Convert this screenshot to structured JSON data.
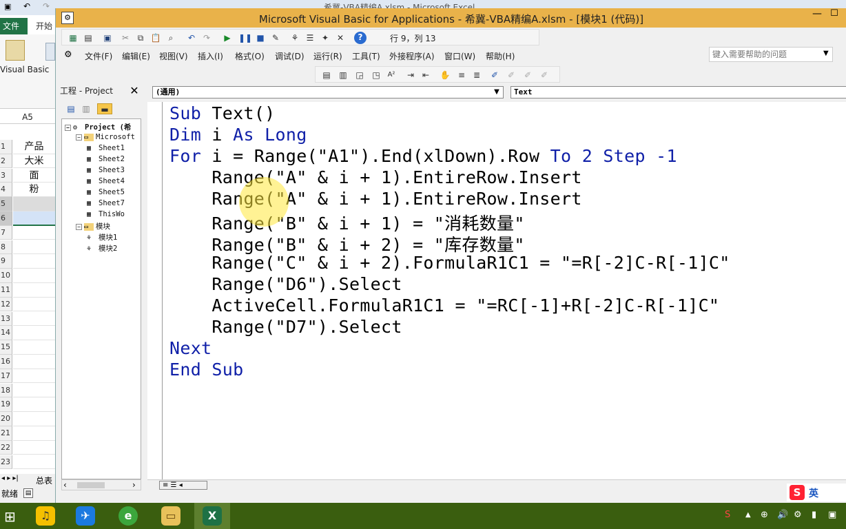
{
  "excel": {
    "title": "希冀-VBA精编A.xlsm - Microsoft Excel",
    "tab_file": "文件",
    "tab_start": "开始",
    "vb_label": "Visual Basic",
    "namebox": "A5",
    "col_a": "A",
    "rows": [
      {
        "n": "1",
        "v": "产品"
      },
      {
        "n": "2",
        "v": "大米"
      },
      {
        "n": "3",
        "v": "面"
      },
      {
        "n": "4",
        "v": "粉"
      },
      {
        "n": "5",
        "v": ""
      },
      {
        "n": "6",
        "v": ""
      },
      {
        "n": "7",
        "v": ""
      },
      {
        "n": "8",
        "v": ""
      },
      {
        "n": "9",
        "v": ""
      },
      {
        "n": "10",
        "v": ""
      },
      {
        "n": "11",
        "v": ""
      },
      {
        "n": "12",
        "v": ""
      },
      {
        "n": "13",
        "v": ""
      },
      {
        "n": "14",
        "v": ""
      },
      {
        "n": "15",
        "v": ""
      },
      {
        "n": "16",
        "v": ""
      },
      {
        "n": "17",
        "v": ""
      },
      {
        "n": "18",
        "v": ""
      },
      {
        "n": "19",
        "v": ""
      },
      {
        "n": "20",
        "v": ""
      },
      {
        "n": "21",
        "v": ""
      },
      {
        "n": "22",
        "v": ""
      },
      {
        "n": "23",
        "v": ""
      }
    ],
    "sheet_tab": "总表",
    "status": "就绪"
  },
  "vbe": {
    "title": "Microsoft Visual Basic for Applications - 希冀-VBA精编A.xlsm - [模块1 (代码)]",
    "cursor_position": "行 9，列 13",
    "menu": [
      "文件(F)",
      "编辑(E)",
      "视图(V)",
      "插入(I)",
      "格式(O)",
      "调试(D)",
      "运行(R)",
      "工具(T)",
      "外接程序(A)",
      "窗口(W)",
      "帮助(H)"
    ],
    "help_placeholder": "键入需要帮助的问题",
    "project_title": "工程 - Project",
    "tree": [
      {
        "label": "Project (希",
        "level": 0,
        "box": "−"
      },
      {
        "label": "Microsoft",
        "level": 1,
        "box": "−"
      },
      {
        "label": "Sheet1",
        "level": 2,
        "box": ""
      },
      {
        "label": "Sheet2",
        "level": 2,
        "box": ""
      },
      {
        "label": "Sheet3",
        "level": 2,
        "box": ""
      },
      {
        "label": "Sheet4",
        "level": 2,
        "box": ""
      },
      {
        "label": "Sheet5",
        "level": 2,
        "box": ""
      },
      {
        "label": "Sheet7",
        "level": 2,
        "box": ""
      },
      {
        "label": "ThisWo",
        "level": 2,
        "box": ""
      },
      {
        "label": "模块",
        "level": 1,
        "box": "−"
      },
      {
        "label": "模块1",
        "level": 2,
        "box": ""
      },
      {
        "label": "模块2",
        "level": 2,
        "box": ""
      }
    ],
    "combo_object": "(通用)",
    "combo_procedure": "Text",
    "code": [
      {
        "indent": "",
        "kw1": "Sub",
        "rest": " Text()",
        "kw2": "",
        "tail": ""
      },
      {
        "indent": "",
        "kw1": "Dim",
        "rest": " i ",
        "kw2": "As Long",
        "tail": ""
      },
      {
        "indent": "",
        "kw1": "For",
        "rest": " i = Range(\"A1\").End(xlDown).Row ",
        "kw2": "To",
        "tail": " 2 Step -1"
      },
      {
        "indent": "    ",
        "kw1": "",
        "rest": "Range(\"A\" & i + 1).EntireRow.Insert",
        "kw2": "",
        "tail": ""
      },
      {
        "indent": "    ",
        "kw1": "",
        "rest": "Range(\"A\" & i + 1).EntireRow.Insert",
        "kw2": "",
        "tail": ""
      },
      {
        "indent": "    ",
        "kw1": "",
        "rest": "Range(\"B\" & i + 1) = \"消耗数量\"",
        "kw2": "",
        "tail": ""
      },
      {
        "indent": "    ",
        "kw1": "",
        "rest": "Range(\"B\" & i + 2) = \"库存数量\"",
        "kw2": "",
        "tail": ""
      },
      {
        "indent": "    ",
        "kw1": "",
        "rest": "Range(\"C\" & i + 2).FormulaR1C1 = \"=R[-2]C-R[-1]C\"",
        "kw2": "",
        "tail": ""
      },
      {
        "indent": "    ",
        "kw1": "",
        "rest": "Range(\"D6\").Select",
        "kw2": "",
        "tail": ""
      },
      {
        "indent": "    ",
        "kw1": "",
        "rest": "ActiveCell.FormulaR1C1 = \"=RC[-1]+R[-2]C-R[-1]C\"",
        "kw2": "",
        "tail": ""
      },
      {
        "indent": "    ",
        "kw1": "",
        "rest": "Range(\"D7\").Select",
        "kw2": "",
        "tail": ""
      },
      {
        "indent": "",
        "kw1": "Next",
        "rest": "",
        "kw2": "",
        "tail": ""
      },
      {
        "indent": "",
        "kw1": "End Sub",
        "rest": "",
        "kw2": "",
        "tail": ""
      }
    ]
  },
  "tray": {
    "ime": "英"
  },
  "colors": {
    "vbe_title": "#e9b24a",
    "keyword": "#1020a8",
    "taskbar": "#3a5e0f",
    "excel_green": "#217346"
  }
}
